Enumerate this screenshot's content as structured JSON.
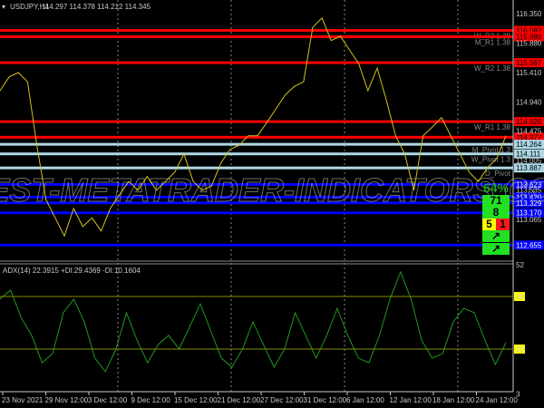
{
  "header": {
    "symbol": "USDJPY,H4",
    "ohlc": "114.297 114.378 114.212 114.345"
  },
  "adx": {
    "label": "ADX(14) 22.3915 +DI:29.4369 -DI:10.1604",
    "axis": [
      "52",
      "40",
      "20",
      "3"
    ],
    "levels": [
      40,
      20
    ]
  },
  "price_axis": [
    "116.350",
    "115.880",
    "115.410",
    "114.940",
    "114.475",
    "114.005",
    "113.535",
    "113.065"
  ],
  "levels": [
    {
      "price": 116.082,
      "label": "116.082",
      "name": "W_R3 1.38",
      "color": "#ff0000",
      "fg": "#000"
    },
    {
      "price": 115.98,
      "label": "115.980",
      "name": "M_R1 1.38",
      "color": "#ff0000",
      "fg": "#000"
    },
    {
      "price": 115.567,
      "label": "115.567",
      "name": "W_R2 1.38",
      "color": "#ff0000",
      "fg": "#000"
    },
    {
      "price": 114.626,
      "label": "114.626",
      "name": "W_R1 1.38",
      "color": "#ff0000",
      "fg": "#000"
    },
    {
      "price": 114.377,
      "label": "114.377",
      "name": "",
      "color": "#ff0000",
      "fg": "#000"
    },
    {
      "price": 114.264,
      "label": "114.264",
      "name": "M_Pivot 1.3",
      "color": "#add8e6",
      "fg": "#000"
    },
    {
      "price": 114.111,
      "label": "114.111",
      "name": "W_Pivot 1.3",
      "color": "#add8e6",
      "fg": "#000"
    },
    {
      "price": 113.887,
      "label": "113.887",
      "name": "D_Pivot",
      "color": "#add8e6",
      "fg": "#000"
    },
    {
      "price": 113.623,
      "label": "113.623",
      "name": "",
      "color": "#0000ff",
      "fg": "#fff"
    },
    {
      "price": 113.42,
      "label": "113.420",
      "name": "",
      "color": "#0000ff",
      "fg": "#fff"
    },
    {
      "price": 113.329,
      "label": "113.329",
      "name": "",
      "color": "#0000ff",
      "fg": "#fff"
    },
    {
      "price": 113.17,
      "label": "113.170",
      "name": "",
      "color": "#0000ff",
      "fg": "#fff"
    },
    {
      "price": 112.655,
      "label": "112.655",
      "name": "",
      "color": "#0000ff",
      "fg": "#fff"
    }
  ],
  "signals": {
    "percent": "64%",
    "s1": "71",
    "s2": "8",
    "s3a": "5",
    "s3sep": "-",
    "s3b": "1",
    "arrow": "↗"
  },
  "watermark": "BEST-METATRADER-INDICATORS.COM",
  "time_axis": [
    "23 Nov 2021",
    "29 Nov 12:00",
    "3 Dec 12:00",
    "9 Dec 12:00",
    "15 Dec 12:00",
    "21 Dec 12:00",
    "27 Dec 12:00",
    "31 Dec 12:00",
    "6 Jan 12:00",
    "12 Jan 12:00",
    "18 Jan 12:00",
    "24 Jan 12:00"
  ],
  "chart_data": {
    "type": "line",
    "price_series": {
      "name": "USDJPY H4",
      "ylim": [
        112.4,
        116.55
      ],
      "values": [
        115.12,
        115.34,
        115.41,
        115.26,
        114.25,
        113.38,
        113.09,
        112.8,
        113.24,
        112.95,
        113.09,
        112.88,
        113.24,
        113.46,
        113.67,
        113.53,
        113.75,
        113.53,
        113.67,
        113.82,
        114.11,
        113.67,
        113.53,
        113.6,
        113.96,
        114.18,
        114.25,
        114.4,
        114.4,
        114.61,
        114.83,
        115.05,
        115.19,
        115.26,
        116.13,
        116.28,
        115.92,
        115.99,
        115.77,
        115.55,
        115.12,
        115.48,
        114.97,
        114.4,
        114.11,
        113.53,
        114.4,
        114.54,
        114.69,
        114.4,
        114.11,
        113.82,
        113.67,
        113.89,
        114.04,
        114.4
      ]
    },
    "adx_series": {
      "name": "ADX(14)",
      "ylim": [
        3,
        52
      ],
      "values": [
        39,
        42.4,
        32,
        25.2,
        14.8,
        18.3,
        33.8,
        39,
        30.3,
        16.6,
        11.4,
        20,
        33.8,
        23.4,
        14.8,
        21.7,
        25.2,
        20,
        28.6,
        37.2,
        26.9,
        16.6,
        13.1,
        20,
        30.3,
        21.7,
        13.1,
        20,
        33.8,
        25.2,
        16.6,
        25.2,
        35.5,
        25.2,
        16.6,
        14.8,
        25.2,
        39,
        49.3,
        39,
        23.4,
        16.6,
        18.3,
        30.3,
        35.5,
        33.8,
        23.4,
        14.1,
        22.4
      ]
    }
  }
}
